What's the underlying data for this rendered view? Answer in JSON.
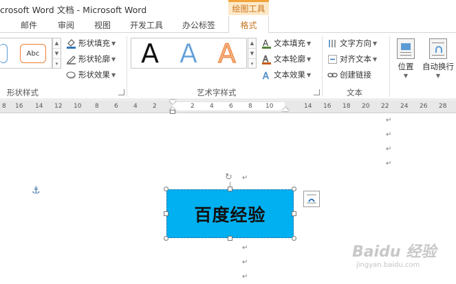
{
  "window": {
    "title": "crosoft Word 文档 - Microsoft Word",
    "contextual_tab": "绘图工具"
  },
  "ribbon_tabs": {
    "mail": "邮件",
    "review": "审阅",
    "view": "视图",
    "developer": "开发工具",
    "office_tab": "办公标签",
    "format": "格式"
  },
  "shape_styles": {
    "sample_label": "Abc",
    "fill": "形状填充",
    "outline": "形状轮廓",
    "effects": "形状效果",
    "group_label": "形状样式"
  },
  "wordart_styles": {
    "samples": [
      "A",
      "A",
      "A"
    ],
    "text_fill": "文本填充",
    "text_outline": "文本轮廓",
    "text_effects": "文本效果",
    "group_label": "艺术字样式"
  },
  "text_group": {
    "direction": "文字方向",
    "align": "对齐文本",
    "link": "创建链接",
    "group_label": "文本"
  },
  "arrange": {
    "position": "位置",
    "wrap": "自动换行"
  },
  "ruler": {
    "left_ticks": [
      "8",
      "16",
      "14",
      "12",
      "10",
      "8",
      "6",
      "4",
      "2"
    ],
    "mid_ticks": [
      "2",
      "4",
      "6",
      "8",
      "10"
    ],
    "right_ticks": [
      "14",
      "16",
      "18",
      "20",
      "22",
      "24",
      "26",
      "28"
    ]
  },
  "document": {
    "paragraph_mark": "↵",
    "textbox_text": "百度经验",
    "textbox_fill": "#00b0f0",
    "rotate_glyph": "↻",
    "anchor_glyph": "⚓"
  },
  "watermark": {
    "main": "Baidu 经验",
    "sub": "jingyan.baidu.com"
  },
  "colors": {
    "accent_orange": "#c9731b",
    "context_bg": "#fde9c8"
  }
}
